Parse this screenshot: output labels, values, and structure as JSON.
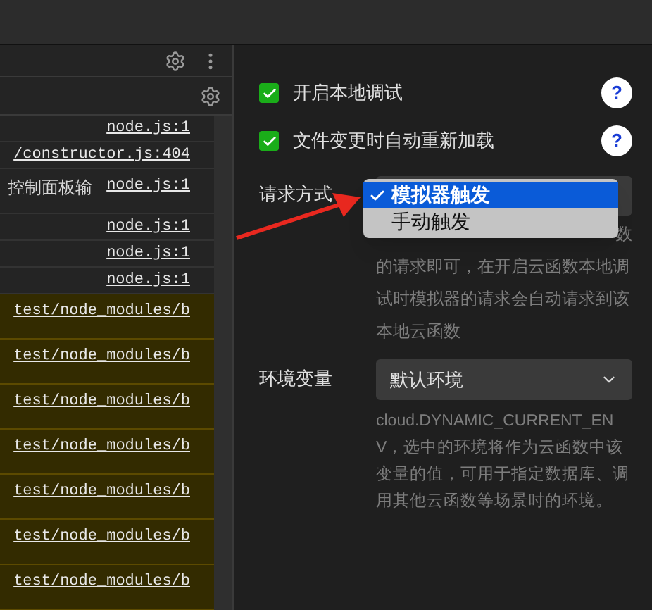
{
  "console": {
    "rows": [
      {
        "kind": "log",
        "source": "node.js:1"
      },
      {
        "kind": "log",
        "source": "/constructor.js:404"
      },
      {
        "kind": "log",
        "message": "控制面板输",
        "source": "node.js:1"
      },
      {
        "kind": "log",
        "source": "node.js:1"
      },
      {
        "kind": "log",
        "source": "node.js:1"
      },
      {
        "kind": "log",
        "source": "node.js:1"
      },
      {
        "kind": "warning",
        "source": "test/node_modules/b"
      },
      {
        "kind": "warning",
        "source": "test/node_modules/b"
      },
      {
        "kind": "warning",
        "source": "test/node_modules/b"
      },
      {
        "kind": "warning",
        "source": "test/node_modules/b"
      },
      {
        "kind": "warning",
        "source": "test/node_modules/b"
      },
      {
        "kind": "warning",
        "source": "test/node_modules/b"
      },
      {
        "kind": "warning",
        "source": "test/node_modules/b"
      }
    ]
  },
  "settings": {
    "checkboxes": [
      {
        "label": "开启本地调试",
        "checked": true,
        "help": "?"
      },
      {
        "label": "文件变更时自动重新加载",
        "checked": true,
        "help": "?"
      }
    ],
    "request_method": {
      "label": "请求方式",
      "dropdown": {
        "options": [
          {
            "label": "模拟器触发",
            "selected": true
          },
          {
            "label": "手动触发",
            "selected": false
          }
        ]
      },
      "description_lines": [
        "数",
        "的请求即可，在开启云函数本地调",
        "试时模拟器的请求会自动请求到该",
        "本地云函数"
      ]
    },
    "environment": {
      "label": "环境变量",
      "value": "默认环境",
      "description": "cloud.DYNAMIC_CURRENT_ENV，选中的环境将作为云函数中该变量的值，可用于指定数据库、调用其他云函数等场景时的环境。"
    }
  }
}
